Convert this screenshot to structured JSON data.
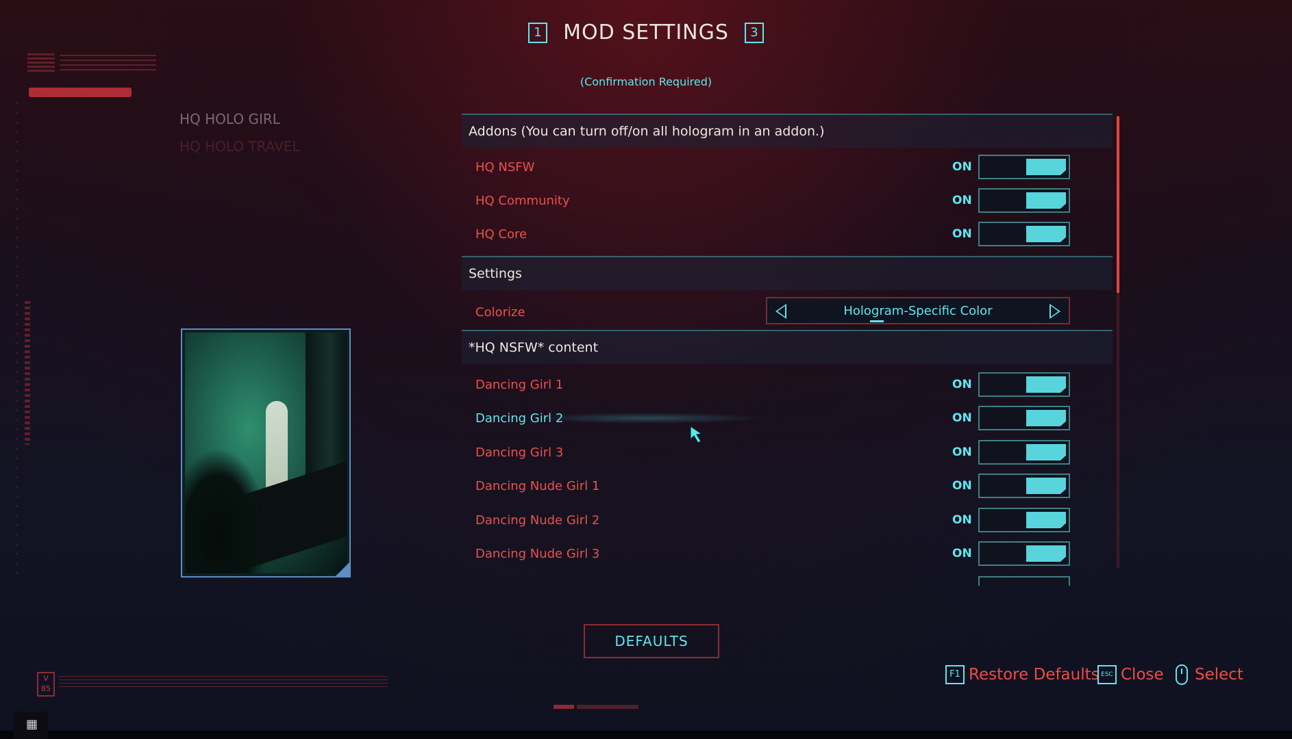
{
  "header": {
    "title": "MOD SETTINGS",
    "prev_key": "1",
    "next_key": "3",
    "subtitle": "(Confirmation Required)"
  },
  "side_menu": {
    "items": [
      {
        "label": "HQ HOLO GIRL"
      },
      {
        "label": "HQ HOLO TRAVEL"
      }
    ]
  },
  "sections": {
    "addons": {
      "title": "Addons (You can turn off/on all hologram in an addon.)"
    },
    "settings": {
      "title": "Settings"
    },
    "nsfw": {
      "title": "*HQ NSFW* content"
    }
  },
  "addons": [
    {
      "label": "HQ NSFW",
      "state": "ON"
    },
    {
      "label": "HQ Community",
      "state": "ON"
    },
    {
      "label": "HQ Core",
      "state": "ON"
    }
  ],
  "colorize": {
    "label": "Colorize",
    "value": "Hologram-Specific Color"
  },
  "nsfw_items": [
    {
      "label": "Dancing Girl 1",
      "state": "ON"
    },
    {
      "label": "Dancing Girl 2",
      "state": "ON"
    },
    {
      "label": "Dancing Girl 3",
      "state": "ON"
    },
    {
      "label": "Dancing Nude Girl 1",
      "state": "ON"
    },
    {
      "label": "Dancing Nude Girl 2",
      "state": "ON"
    },
    {
      "label": "Dancing Nude Girl 3",
      "state": "ON"
    }
  ],
  "footer": {
    "defaults_label": "DEFAULTS",
    "restore_key": "F1",
    "restore_label": "Restore Defaults",
    "close_key": "ESC",
    "close_label": "Close",
    "select_label": "Select"
  },
  "colors": {
    "accent_cyan": "#5ee7ef",
    "accent_red": "#e8524c",
    "toggle_on": "#58d4dd"
  },
  "icons": {
    "cursor": "hand-cursor-icon",
    "mouse": "mouse-icon",
    "grid": "grid-icon"
  }
}
